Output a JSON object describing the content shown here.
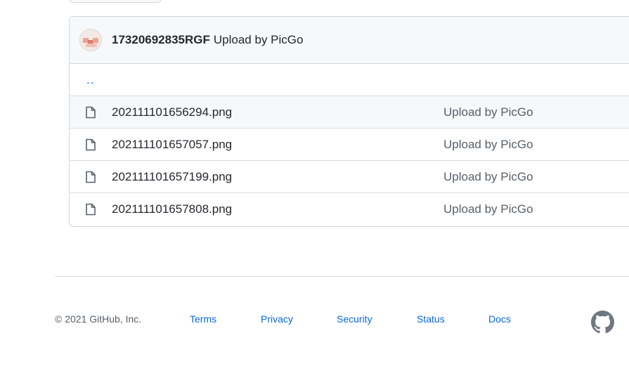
{
  "commit": {
    "author": "17320692835RGF",
    "message": "Upload by PicGo"
  },
  "parent_link": "..",
  "files": [
    {
      "name": "202111101656294.png",
      "commit_message": "Upload by PicGo"
    },
    {
      "name": "202111101657057.png",
      "commit_message": "Upload by PicGo"
    },
    {
      "name": "202111101657199.png",
      "commit_message": "Upload by PicGo"
    },
    {
      "name": "202111101657808.png",
      "commit_message": "Upload by PicGo"
    }
  ],
  "footer": {
    "copyright": "© 2021 GitHub, Inc.",
    "links": [
      "Terms",
      "Privacy",
      "Security",
      "Status",
      "Docs"
    ]
  },
  "icons": {
    "file": "file-icon",
    "logo": "github-logo-icon"
  },
  "colors": {
    "link": "#0969da",
    "text": "#24292f",
    "muted": "#57606a",
    "border": "#d0d7de",
    "header_bg": "#f6f8fa"
  }
}
